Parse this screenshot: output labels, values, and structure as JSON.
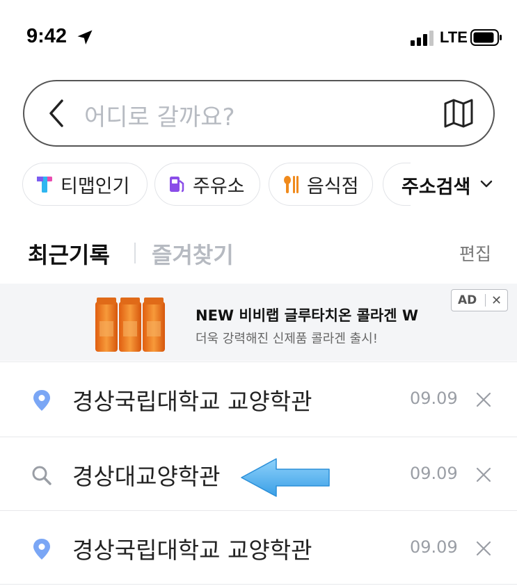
{
  "status_bar": {
    "time": "9:42",
    "carrier": "LTE",
    "icons": [
      "location-arrow-icon",
      "signal-bars-icon",
      "battery-icon"
    ]
  },
  "search": {
    "placeholder": "어디로 갈까요?",
    "back_icon": "chevron-left-icon",
    "map_icon": "map-icon"
  },
  "categories": [
    {
      "label": "티맵인기",
      "icon": "tmap-logo-icon",
      "color": "#3d6df2"
    },
    {
      "label": "주유소",
      "icon": "gas-station-icon",
      "color": "#8a4de8"
    },
    {
      "label": "음식점",
      "icon": "food-icon",
      "color": "#f08a1c"
    }
  ],
  "address_search": {
    "label": "주소검색",
    "icon": "chevron-down-icon"
  },
  "tabs": {
    "recent": "최근기록",
    "favorites": "즐겨찾기",
    "edit": "편집"
  },
  "ad": {
    "title": "NEW 비비랩 글루타치온 콜라겐 W",
    "subtitle": "더욱 강력해진 신제품 콜라겐 출시!",
    "badge": "AD",
    "close": "✕"
  },
  "history": [
    {
      "name": "경상국립대학교 교양학관",
      "date": "09.09",
      "icon": "location-pin-icon"
    },
    {
      "name": "경상대교양학관",
      "date": "09.09",
      "icon": "search-icon"
    },
    {
      "name": "경상국립대학교 교양학관",
      "date": "09.09",
      "icon": "location-pin-icon"
    }
  ],
  "colors": {
    "pin": "#7aa6f5",
    "annotation_arrow": "#5ab4f0",
    "ad_product": "#f07a1a"
  }
}
